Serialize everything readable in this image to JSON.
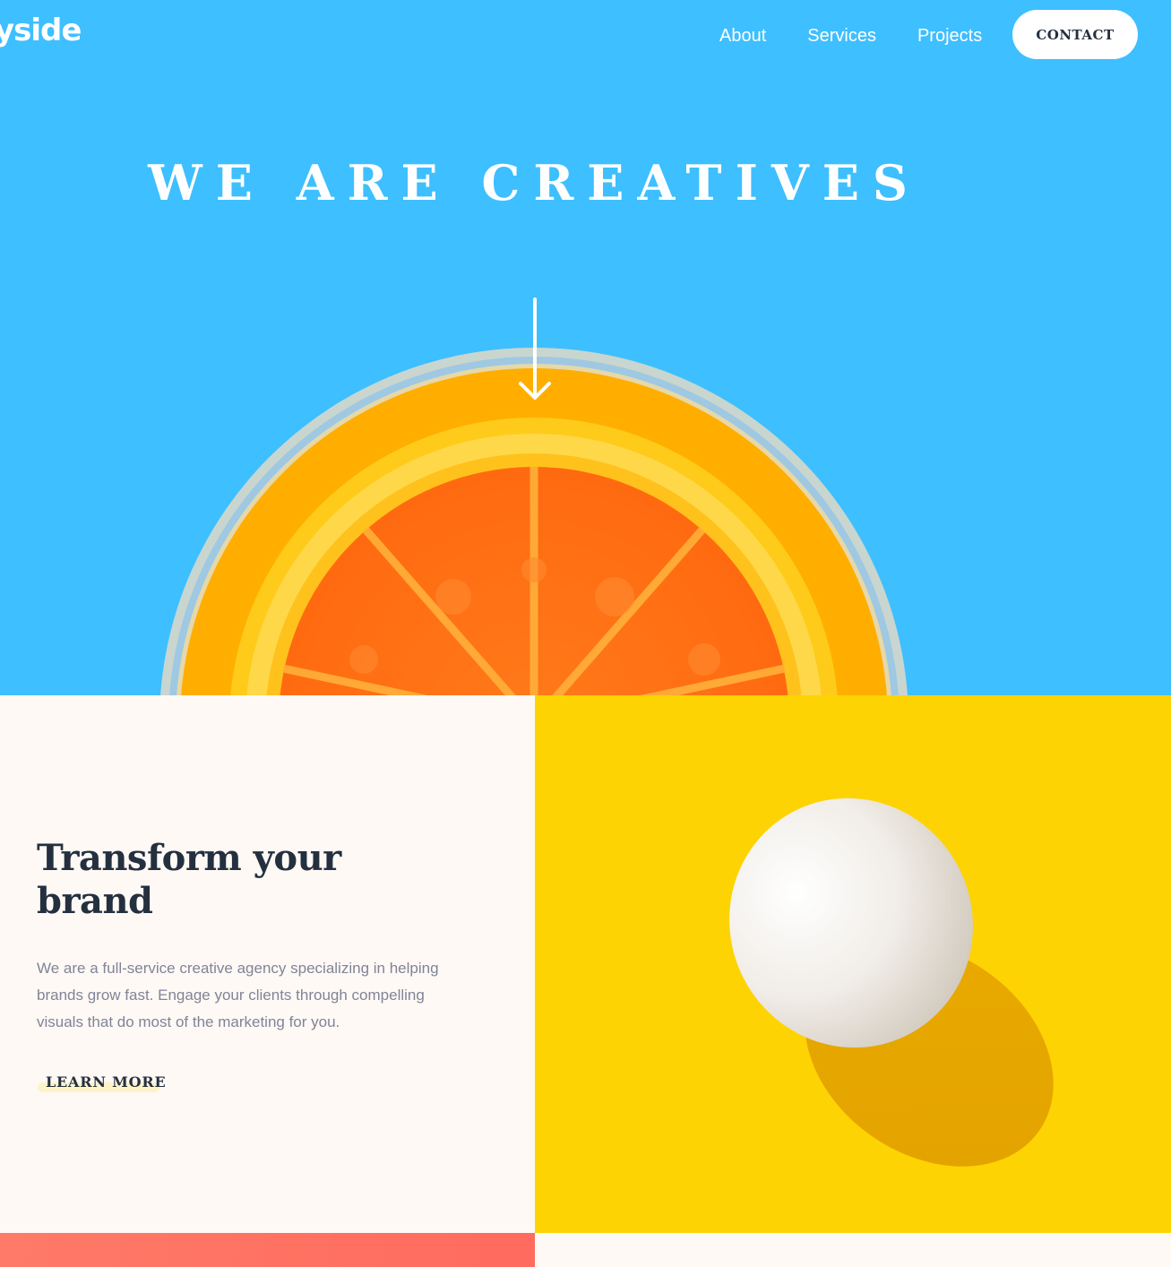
{
  "header": {
    "logo_text": "yside",
    "nav": [
      "About",
      "Services",
      "Projects"
    ],
    "contact_label": "CONTACT"
  },
  "hero": {
    "title": "WE ARE CREATIVES",
    "image_icon": "orange-slice-in-glass",
    "arrow_icon": "arrow-down-icon",
    "background": "#3ebfff"
  },
  "transform": {
    "title": "Transform your brand",
    "body": "We are a full-service creative agency specializing in helping brands grow fast. Engage your clients through compelling visuals that do most of the marketing for you.",
    "cta": "LEARN MORE",
    "image_icon": "egg-image",
    "image_background": "#fed303"
  },
  "colors": {
    "dark_text": "#24303f",
    "body_text": "#818498",
    "cream": "#fef9f5",
    "coral": "#ff6b5e",
    "highlight": "#fdf3c8"
  }
}
